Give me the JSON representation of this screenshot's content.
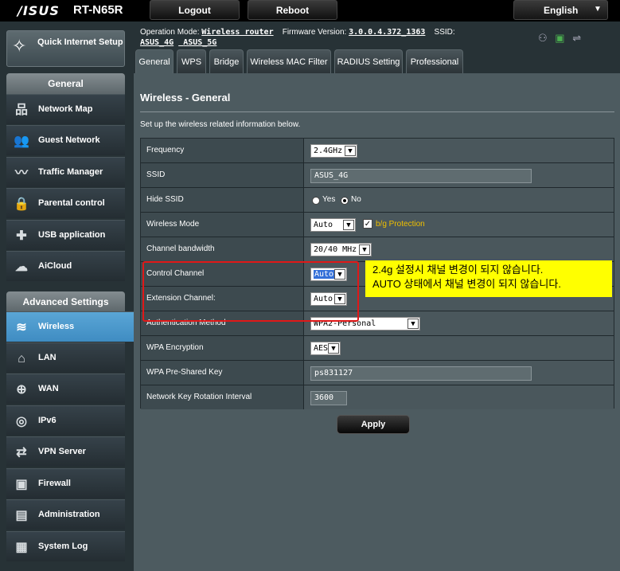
{
  "header": {
    "brand": "/ISUS",
    "model": "RT-N65R",
    "logout": "Logout",
    "reboot": "Reboot",
    "language": "English"
  },
  "sidebar": {
    "quick_setup": "Quick Internet Setup",
    "general_title": "General",
    "general_items": [
      {
        "label": "Network Map",
        "icon": "network-map-icon"
      },
      {
        "label": "Guest Network",
        "icon": "guest-network-icon"
      },
      {
        "label": "Traffic Manager",
        "icon": "traffic-manager-icon"
      },
      {
        "label": "Parental control",
        "icon": "parental-control-icon"
      },
      {
        "label": "USB application",
        "icon": "usb-icon"
      },
      {
        "label": "AiCloud",
        "icon": "cloud-icon"
      }
    ],
    "advanced_title": "Advanced Settings",
    "advanced_items": [
      {
        "label": "Wireless",
        "icon": "wireless-icon"
      },
      {
        "label": "LAN",
        "icon": "lan-icon"
      },
      {
        "label": "WAN",
        "icon": "wan-icon"
      },
      {
        "label": "IPv6",
        "icon": "ipv6-icon"
      },
      {
        "label": "VPN Server",
        "icon": "vpn-icon"
      },
      {
        "label": "Firewall",
        "icon": "firewall-icon"
      },
      {
        "label": "Administration",
        "icon": "admin-icon"
      },
      {
        "label": "System Log",
        "icon": "log-icon"
      }
    ]
  },
  "info": {
    "op_mode_label": "Operation Mode:",
    "op_mode": "Wireless router",
    "fw_label": "Firmware Version:",
    "fw": "3.0.0.4.372_1363",
    "ssid_label": "SSID:",
    "ssid1": "ASUS_4G",
    "ssid2": "ASUS_5G"
  },
  "tabs": [
    "General",
    "WPS",
    "Bridge",
    "Wireless MAC Filter",
    "RADIUS Setting",
    "Professional"
  ],
  "page": {
    "title": "Wireless - General",
    "description": "Set up the wireless related information below."
  },
  "form": {
    "frequency_label": "Frequency",
    "frequency": "2.4GHz",
    "ssid_label": "SSID",
    "ssid": "ASUS_4G",
    "hide_ssid_label": "Hide SSID",
    "yes": "Yes",
    "no": "No",
    "mode_label": "Wireless Mode",
    "mode": "Auto",
    "bg_protection": "b/g Protection",
    "bandwidth_label": "Channel bandwidth",
    "bandwidth": "20/40 MHz",
    "control_label": "Control Channel",
    "control": "Auto",
    "extension_label": "Extension Channel:",
    "extension": "Auto",
    "auth_label": "Authentication Method",
    "auth": "WPA2-Personal",
    "enc_label": "WPA Encryption",
    "enc": "AES",
    "psk_label": "WPA Pre-Shared Key",
    "psk": "ps831127",
    "rotation_label": "Network Key Rotation Interval",
    "rotation": "3600",
    "apply": "Apply"
  },
  "annotation": {
    "line1": "2.4g 설정시 채널 변경이 되지 않습니다.",
    "line2": "AUTO 상태에서 채널 변경이 되지 않습니다."
  },
  "colors": {
    "active_menu": "#4a9ad0",
    "note_bg": "#ffff00",
    "highlight_box": "#e01818",
    "bg_protection_text": "#f0c000"
  }
}
